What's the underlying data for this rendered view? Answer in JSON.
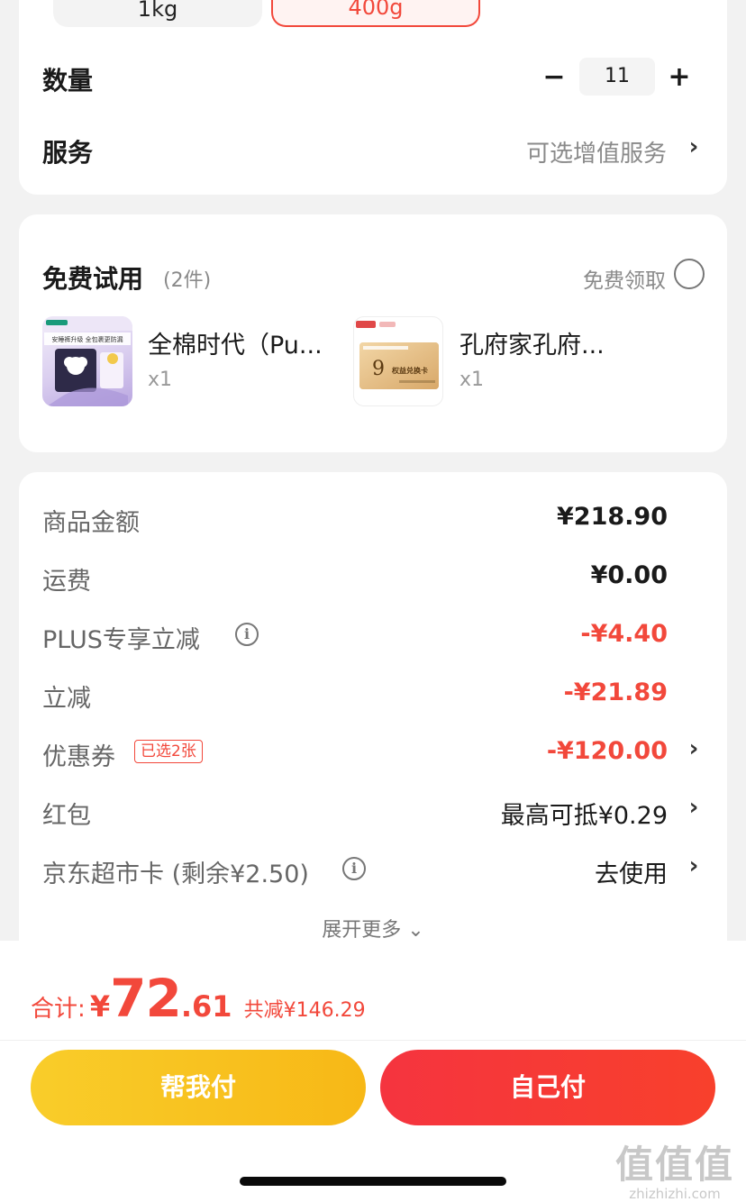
{
  "spec": {
    "options": [
      "1kg",
      "400g"
    ],
    "selected": "400g"
  },
  "quantity": {
    "label": "数量",
    "minus": "−",
    "value": "11",
    "plus": "+"
  },
  "service": {
    "label": "服务",
    "value": "可选增值服务",
    "chevron": "›"
  },
  "trial": {
    "title": "免费试用",
    "count": "(2件)",
    "claim_label": "免费领取",
    "items": [
      {
        "name": "全棉时代（Pu...",
        "qty": "x1",
        "icon": "diaper-pack-image",
        "img_text": [
          "安睡裤升级 全包裹更防漏"
        ]
      },
      {
        "name": "孔府家孔府...",
        "qty": "x1",
        "icon": "voucher-card-image",
        "img_text": [
          "9",
          "权益兑换卡"
        ]
      }
    ]
  },
  "price": {
    "rows": [
      {
        "label": "商品金额",
        "value": "¥218.90"
      },
      {
        "label": "运费",
        "value": "¥0.00"
      },
      {
        "label": "PLUS专享立减",
        "value": "-¥4.40"
      },
      {
        "label": "立减",
        "value": "-¥21.89"
      },
      {
        "label": "优惠券",
        "value": "-¥120.00",
        "badge": "已选2张"
      },
      {
        "label": "红包",
        "value": "最高可抵¥0.29"
      },
      {
        "label": "京东超市卡 (剩余¥2.50)",
        "value": "去使用"
      }
    ],
    "expand_label": "展开更多 ⌄",
    "chevron": "›"
  },
  "total": {
    "label": "合计:",
    "yen": "¥",
    "int": "72",
    "dec": ".61",
    "save_label": "共减¥146.29"
  },
  "buttons": {
    "help_pay": "帮我付",
    "self_pay": "自己付"
  },
  "watermark": {
    "big": "值值值",
    "url": "zhizhizhi.com"
  },
  "colors": {
    "accent_red": "#f2483b",
    "yellow": "#f7b816"
  }
}
